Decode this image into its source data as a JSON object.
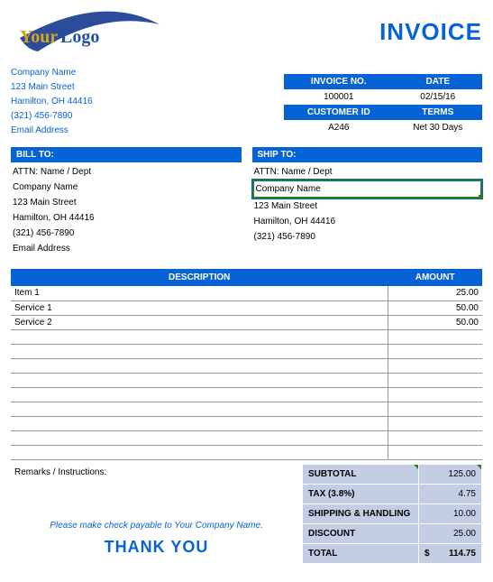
{
  "logo": {
    "word1": "Your",
    "word2": "Logo"
  },
  "title": "INVOICE",
  "company": {
    "name": "Company Name",
    "street": "123 Main Street",
    "city": "Hamilton, OH  44416",
    "phone": "(321) 456-7890",
    "email": "Email Address"
  },
  "meta": {
    "invoice_no_hdr": "INVOICE NO.",
    "date_hdr": "DATE",
    "invoice_no": "100001",
    "date": "02/15/16",
    "customer_id_hdr": "CUSTOMER ID",
    "terms_hdr": "TERMS",
    "customer_id": "A246",
    "terms": "Net 30 Days"
  },
  "bill": {
    "hdr": "BILL TO:",
    "attn": "ATTN: Name / Dept",
    "company": "Company Name",
    "street": "123 Main Street",
    "city": "Hamilton, OH  44416",
    "phone": "(321) 456-7890",
    "email": "Email Address"
  },
  "ship": {
    "hdr": "SHIP TO:",
    "attn": "ATTN: Name / Dept",
    "company": "Company Name",
    "street": "123 Main Street",
    "city": "Hamilton, OH  44416",
    "phone": "(321) 456-7890"
  },
  "items": {
    "desc_hdr": "DESCRIPTION",
    "amt_hdr": "AMOUNT",
    "rows": [
      {
        "desc": "Item 1",
        "amt": "25.00"
      },
      {
        "desc": "Service 1",
        "amt": "50.00"
      },
      {
        "desc": "Service 2",
        "amt": "50.00"
      },
      {
        "desc": "",
        "amt": ""
      },
      {
        "desc": "",
        "amt": ""
      },
      {
        "desc": "",
        "amt": ""
      },
      {
        "desc": "",
        "amt": ""
      },
      {
        "desc": "",
        "amt": ""
      },
      {
        "desc": "",
        "amt": ""
      },
      {
        "desc": "",
        "amt": ""
      },
      {
        "desc": "",
        "amt": ""
      },
      {
        "desc": "",
        "amt": ""
      }
    ]
  },
  "remarks": {
    "title": "Remarks / Instructions:",
    "paynote": "Please make check payable to Your Company Name.",
    "thankyou": "THANK YOU"
  },
  "totals": {
    "subtotal_label": "SUBTOTAL",
    "subtotal": "125.00",
    "tax_label": "TAX (3.8%)",
    "tax": "4.75",
    "ship_label": "SHIPPING & HANDLING",
    "ship": "10.00",
    "discount_label": "DISCOUNT",
    "discount": "25.00",
    "total_label": "TOTAL",
    "total": "114.75"
  }
}
